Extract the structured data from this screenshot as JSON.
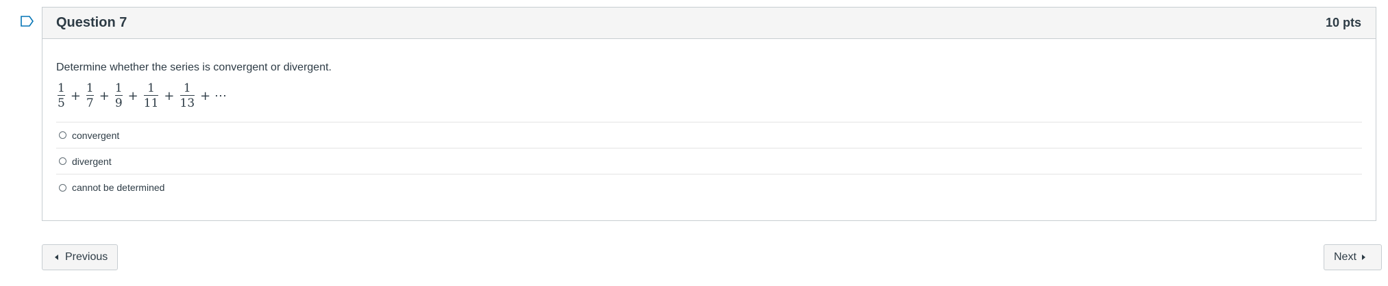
{
  "question": {
    "title": "Question 7",
    "points": "10 pts",
    "prompt": "Determine whether the series is convergent or divergent.",
    "series_terms": [
      {
        "num": "1",
        "den": "5"
      },
      {
        "num": "1",
        "den": "7"
      },
      {
        "num": "1",
        "den": "9"
      },
      {
        "num": "1",
        "den": "11"
      },
      {
        "num": "1",
        "den": "13"
      }
    ],
    "plus": "+",
    "ellipsis": "+ ⋯",
    "answers": [
      "convergent",
      "divergent",
      "cannot be determined"
    ]
  },
  "nav": {
    "previous_label": "Previous",
    "next_label": "Next"
  },
  "colors": {
    "accent_flag": "#0374b5",
    "text": "#2d3b45",
    "border": "#c7cdd1"
  }
}
